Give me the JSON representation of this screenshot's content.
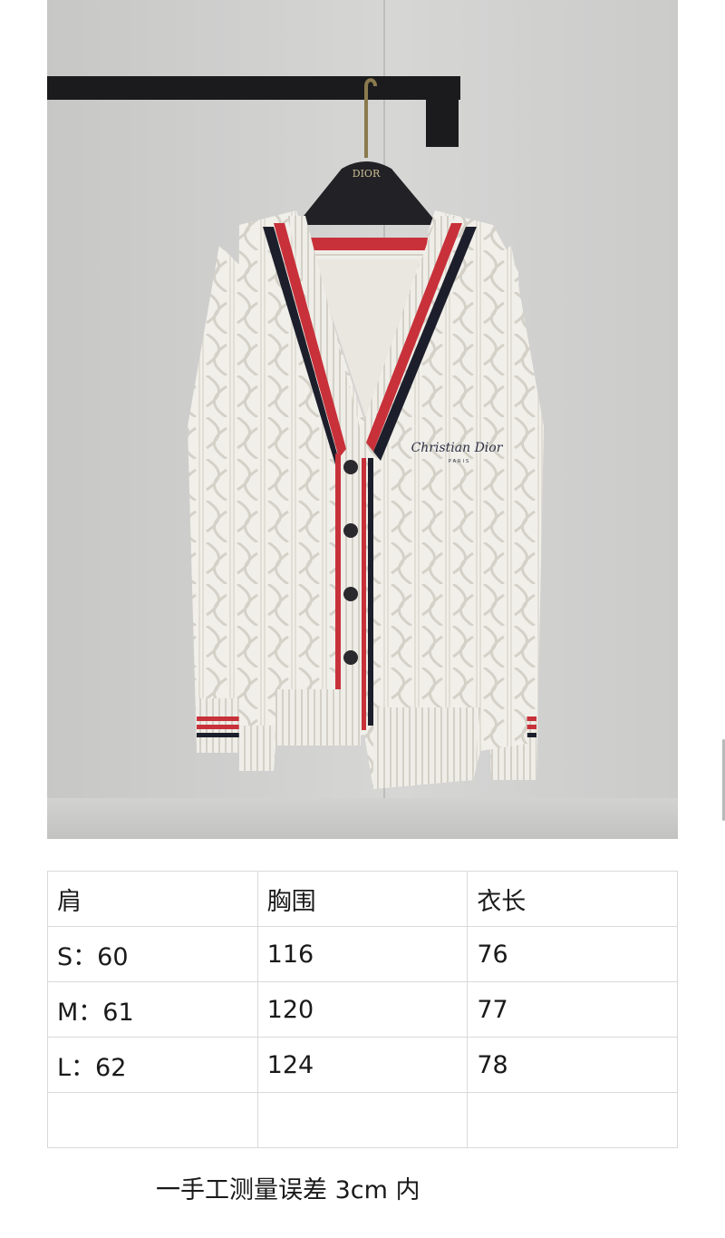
{
  "photo": {
    "hanger_brand": "DIOR",
    "embroidery_text": "Christian Dior",
    "embroidery_subtext": "PARIS",
    "colors": {
      "knit": "#f2f0ea",
      "stripe_red": "#c8313a",
      "stripe_navy": "#1c1f2b",
      "wall": "#cfcfce",
      "rail": "#1b1b1d"
    }
  },
  "size_table": {
    "header": [
      "肩",
      "胸围",
      "衣长"
    ],
    "rows": [
      [
        "S：60",
        "116",
        "76"
      ],
      [
        "M：61",
        "120",
        "77"
      ],
      [
        "L：62",
        "124",
        "78"
      ],
      [
        "",
        "",
        ""
      ]
    ]
  },
  "footnote": "一手工测量误差 3cm 内"
}
